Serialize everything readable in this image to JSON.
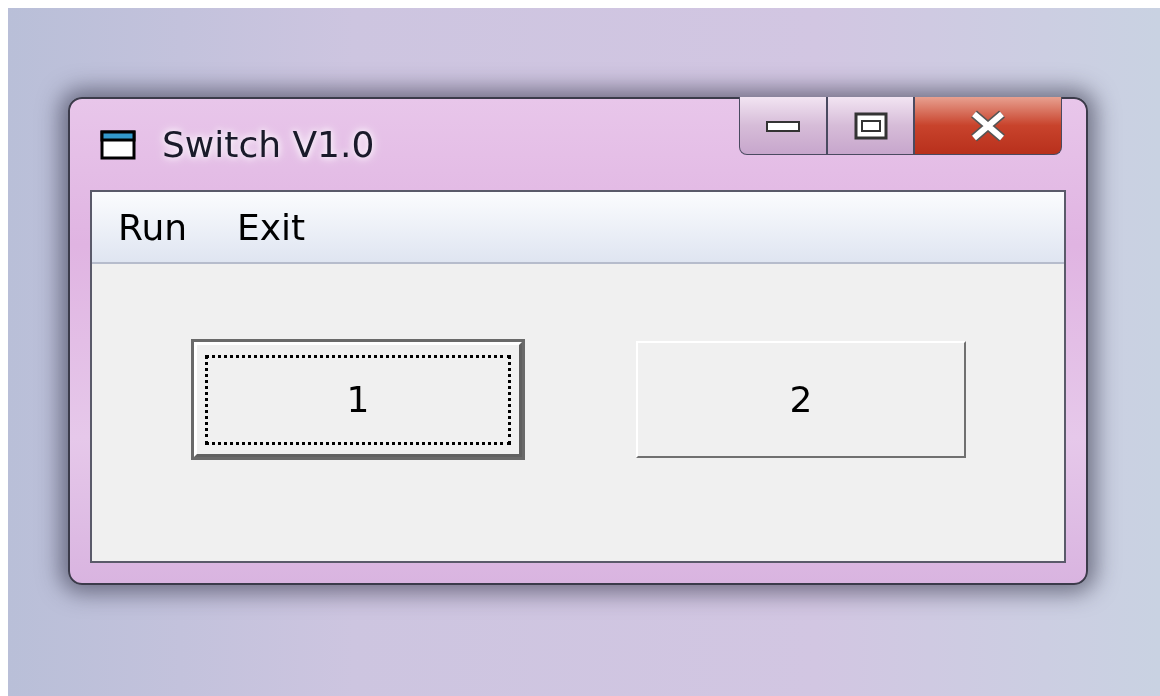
{
  "window": {
    "title": "Switch V1.0"
  },
  "menu": [
    {
      "label": "Run"
    },
    {
      "label": "Exit"
    }
  ],
  "buttons": [
    {
      "label": "1",
      "focused": true
    },
    {
      "label": "2",
      "focused": false
    }
  ]
}
